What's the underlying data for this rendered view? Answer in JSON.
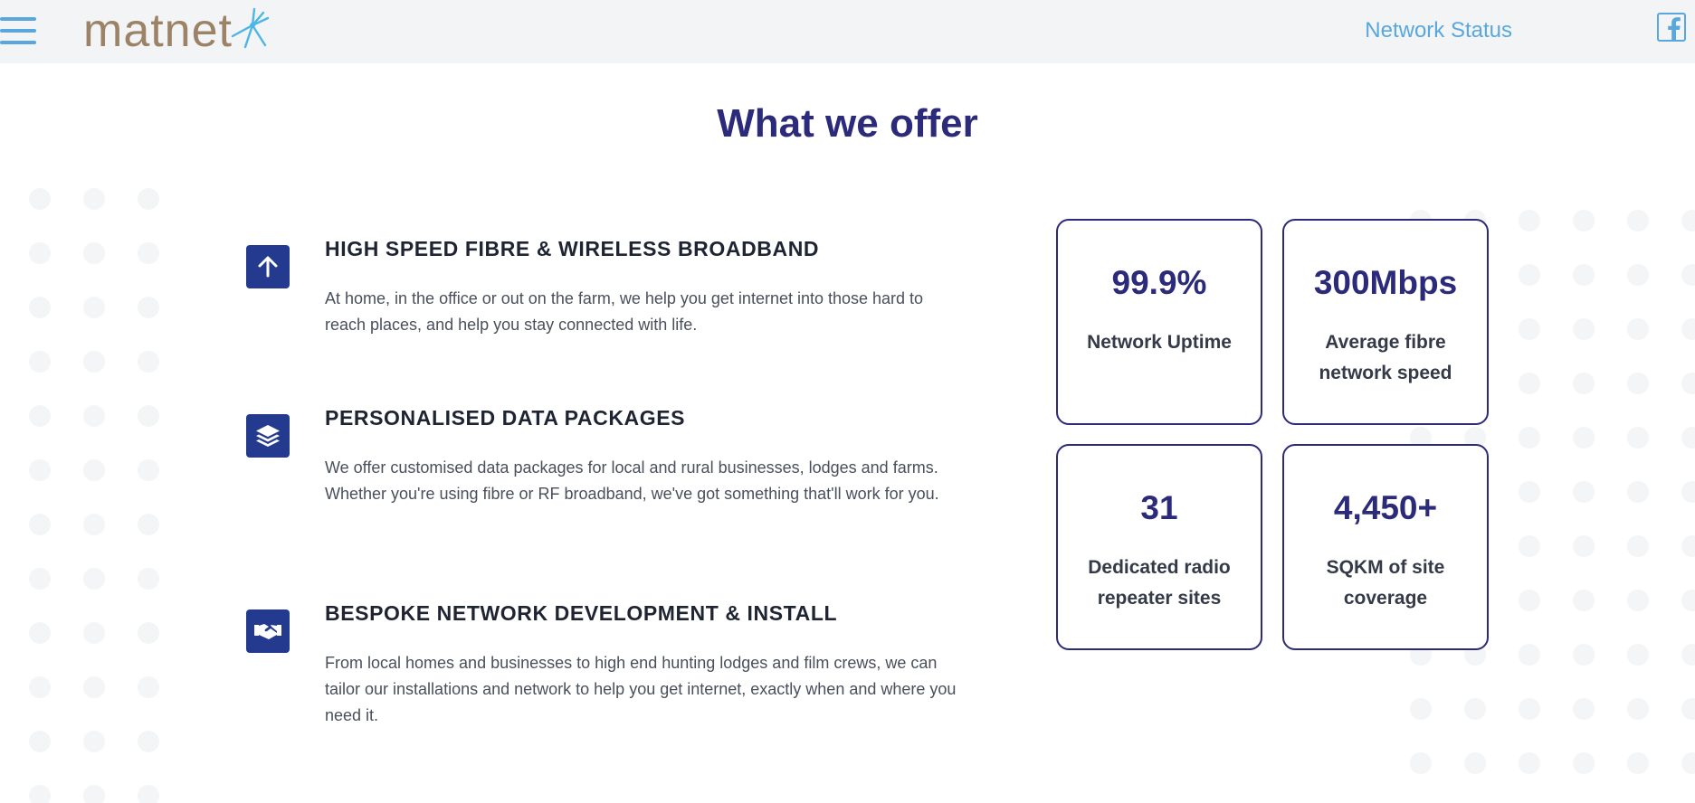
{
  "header": {
    "logo_text": "matnet",
    "menu_icon": "hamburger-menu-icon",
    "network_status_label": "Network Status",
    "social_icon": "facebook-icon",
    "background_color": "#f2f4f5",
    "accent_color": "#5aa7dd"
  },
  "main": {
    "title": "What we offer",
    "title_color": "#2c2a7a",
    "features": [
      {
        "icon": "arrow-up-icon",
        "title": "HIGH SPEED FIBRE & WIRELESS BROADBAND",
        "description": "At home, in the office or out on the farm, we help you get internet into those hard to reach places, and help you stay connected with life."
      },
      {
        "icon": "layers-icon",
        "title": "PERSONALISED DATA PACKAGES",
        "description": "We offer customised data packages for local and rural businesses, lodges and farms. Whether you're using fibre or RF broadband, we've got something that'll work for you."
      },
      {
        "icon": "handshake-icon",
        "title": "BESPOKE NETWORK DEVELOPMENT & INSTALL",
        "description": "From local homes and businesses to high end hunting lodges and film crews, we can tailor our installations and network to help you get internet, exactly when and where you need it."
      }
    ],
    "stats": [
      {
        "value": "99.9%",
        "label": "Network Uptime"
      },
      {
        "value": "300Mbps",
        "label": "Average fibre network speed"
      },
      {
        "value": "31",
        "label": "Dedicated radio repeater sites"
      },
      {
        "value": "4,450+",
        "label": "SQKM of site coverage"
      }
    ],
    "icon_tile_color": "#243a8e"
  }
}
